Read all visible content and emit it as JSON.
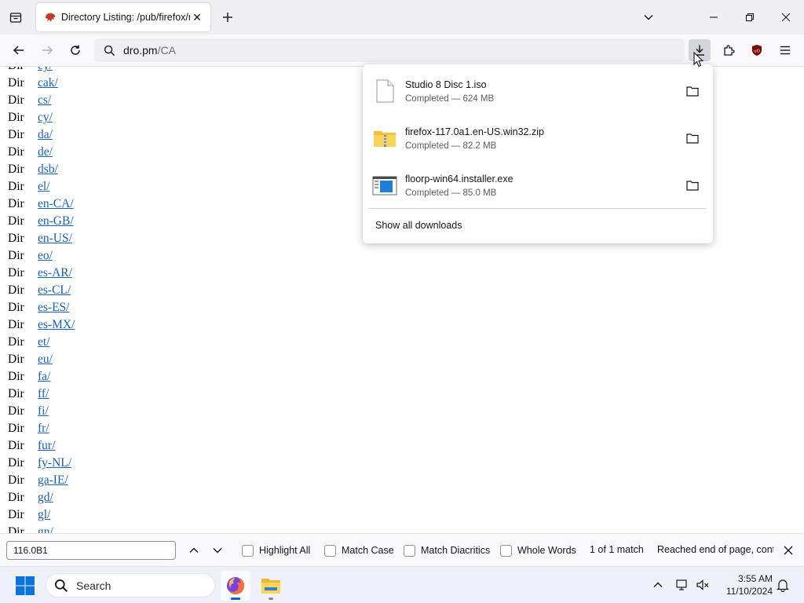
{
  "tab": {
    "title": "Directory Listing: /pub/firefox/r",
    "close_glyph": "✕"
  },
  "urlbar": {
    "host": "dro.pm",
    "path": "/CA"
  },
  "listing": {
    "kind": "Dir",
    "partial_top": "cy/",
    "entries": [
      "cak/",
      "cs/",
      "cy/",
      "da/",
      "de/",
      "dsb/",
      "el/",
      "en-CA/",
      "en-GB/",
      "en-US/",
      "eo/",
      "es-AR/",
      "es-CL/",
      "es-ES/",
      "es-MX/",
      "et/",
      "eu/",
      "fa/",
      "ff/",
      "fi/",
      "fr/",
      "fur/",
      "fy-NL/",
      "ga-IE/",
      "gd/",
      "gl/",
      "gn/"
    ]
  },
  "downloads": {
    "items": [
      {
        "name": "Studio 8 Disc 1.iso",
        "status": "Completed — 624 MB",
        "icon": "generic-file-icon"
      },
      {
        "name": "firefox-117.0a1.en-US.win32.zip",
        "status": "Completed — 82.2 MB",
        "icon": "zip-folder-icon"
      },
      {
        "name": "floorp-win64.installer.exe",
        "status": "Completed — 85.0 MB",
        "icon": "installer-icon"
      }
    ],
    "show_all": "Show all downloads"
  },
  "findbar": {
    "query": "116.0B1",
    "options": [
      {
        "label": "Highlight All",
        "checked": false
      },
      {
        "label": "Match Case",
        "checked": false
      },
      {
        "label": "Match Diacritics",
        "checked": false
      },
      {
        "label": "Whole Words",
        "checked": false
      }
    ],
    "match_count": "1 of 1 match",
    "status": "Reached end of page, contir"
  },
  "taskbar": {
    "search_label": "Search",
    "time": "3:55 AM",
    "date": "11/10/2024"
  },
  "colors": {
    "link": "#1a5fb4",
    "accent": "#0067c0",
    "ublock_red": "#800000"
  }
}
